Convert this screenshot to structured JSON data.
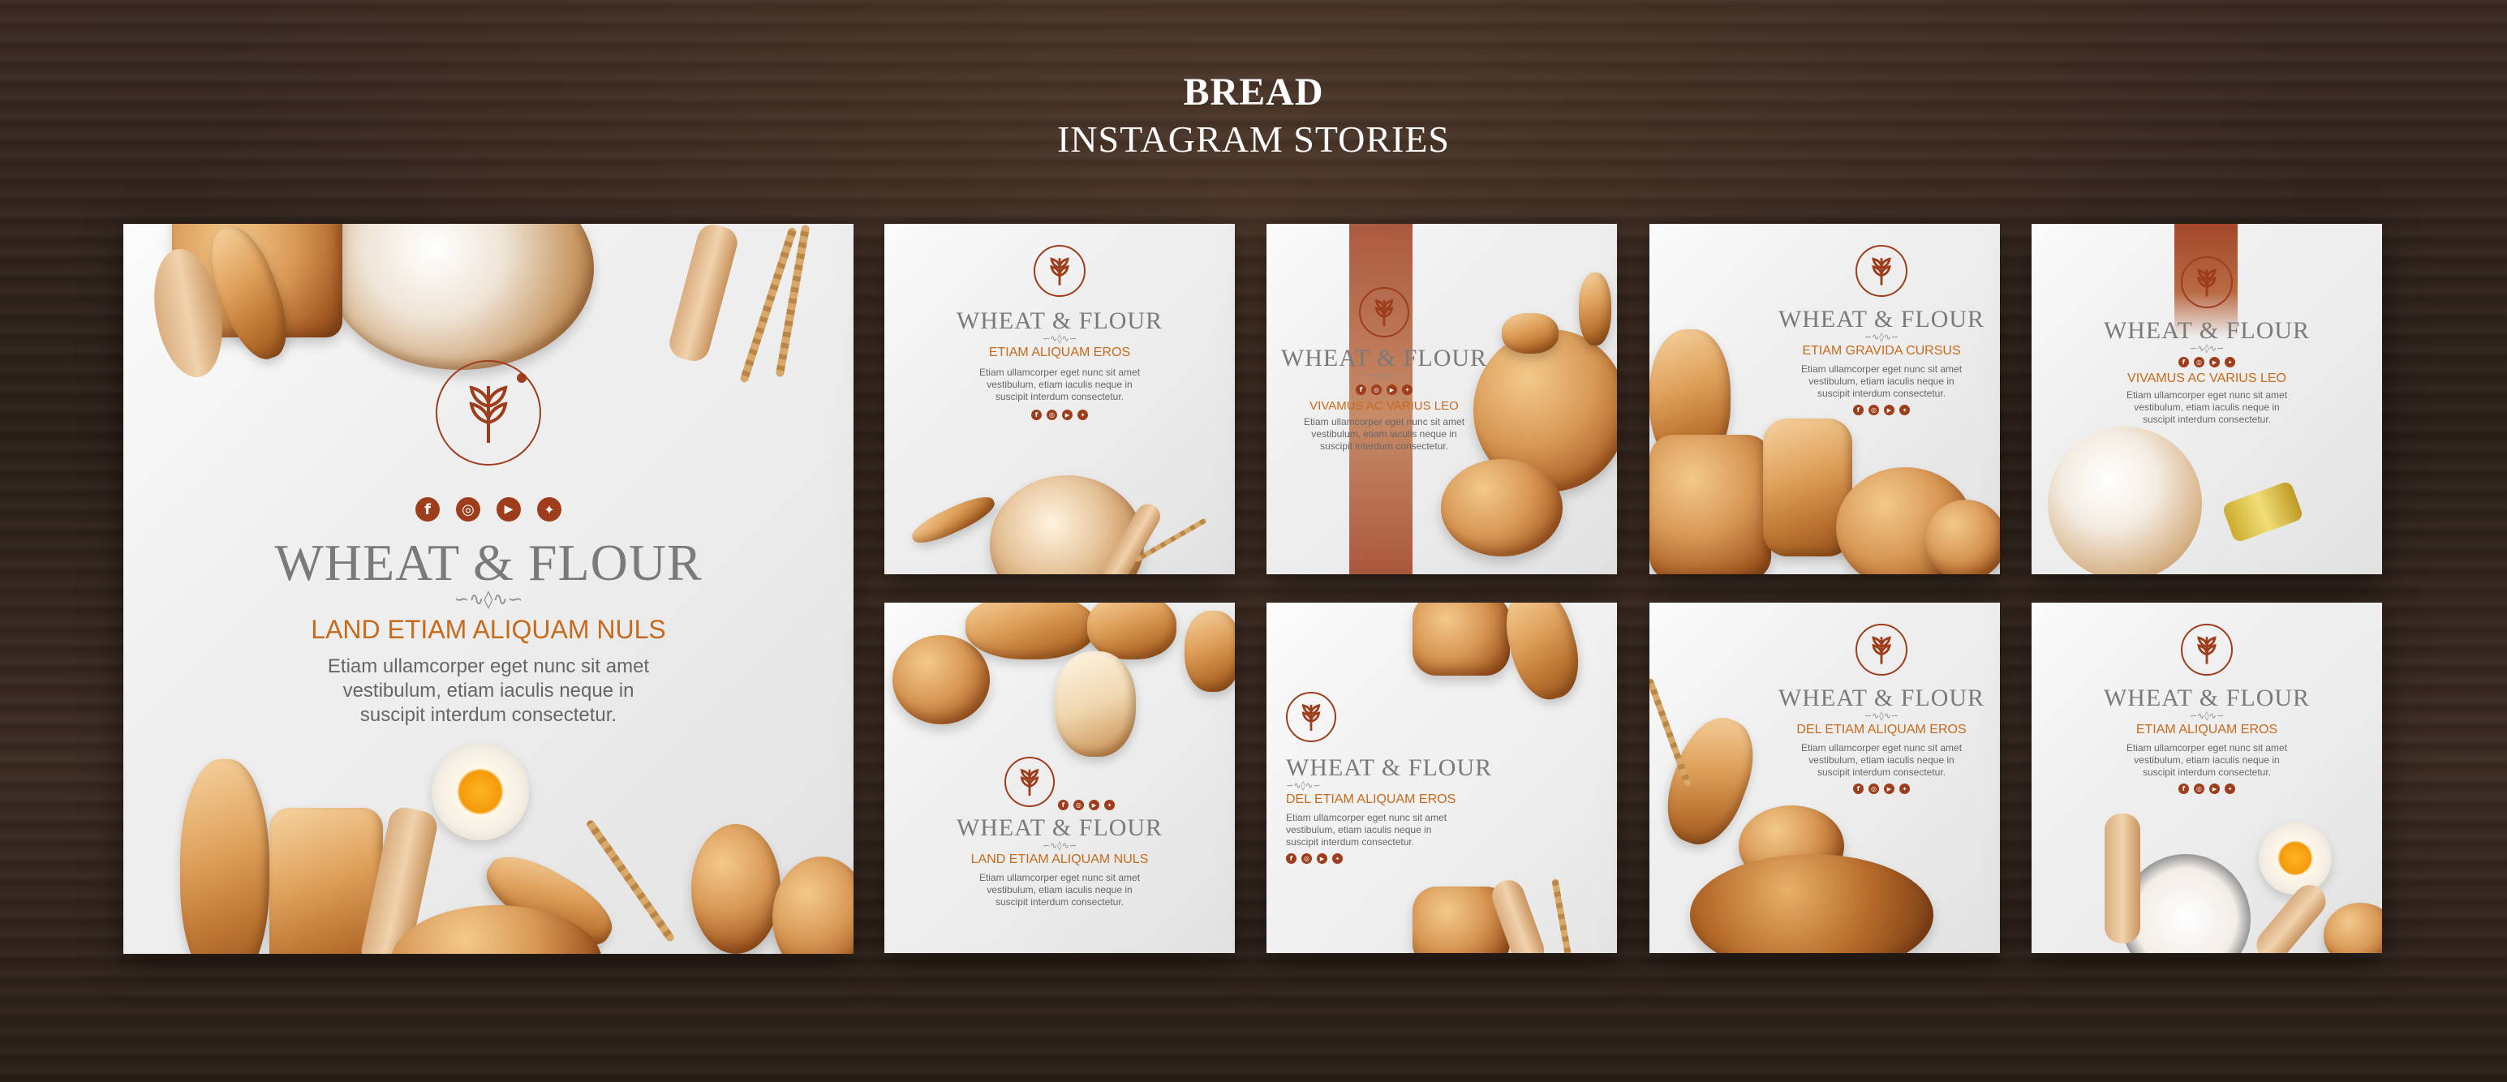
{
  "header": {
    "title": "BREAD",
    "subtitle": "INSTAGRAM STORIES"
  },
  "colors": {
    "brand_brown": "#9e3d1c",
    "accent_orange": "#c66a1d",
    "brand_gray": "#7a7a7a"
  },
  "social_icons": [
    "facebook-icon",
    "instagram-icon",
    "youtube-icon",
    "twitter-icon"
  ],
  "ornament": "∽∿◊∿∽",
  "cards": [
    {
      "brand": "WHEAT & FLOUR",
      "tagline": "LAND ETIAM ALIQUAM NULS",
      "body": "Etiam ullamcorper eget nunc sit amet vestibulum, etiam iaculis neque in suscipit interdum consectetur."
    },
    {
      "brand": "WHEAT & FLOUR",
      "tagline": "ETIAM ALIQUAM EROS",
      "body": "Etiam ullamcorper eget nunc sit amet vestibulum, etiam iaculis neque in suscipit interdum consectetur."
    },
    {
      "brand": "WHEAT & FLOUR",
      "tagline": "VIVAMUS AC VARIUS LEO",
      "body": "Etiam ullamcorper eget nunc sit amet vestibulum, etiam iaculis neque in suscipit interdum consectetur."
    },
    {
      "brand": "WHEAT & FLOUR",
      "tagline": "ETIAM GRAVIDA CURSUS",
      "body": "Etiam ullamcorper eget nunc sit amet vestibulum, etiam iaculis neque in suscipit interdum consectetur."
    },
    {
      "brand": "WHEAT & FLOUR",
      "tagline": "VIVAMUS AC VARIUS LEO",
      "body": "Etiam ullamcorper eget nunc sit amet vestibulum, etiam iaculis neque in suscipit interdum consectetur."
    },
    {
      "brand": "WHEAT & FLOUR",
      "tagline": "LAND ETIAM ALIQUAM NULS",
      "body": "Etiam ullamcorper eget nunc sit amet vestibulum, etiam iaculis neque in suscipit interdum consectetur."
    },
    {
      "brand": "WHEAT & FLOUR",
      "tagline": "DEL ETIAM ALIQUAM EROS",
      "body": "Etiam ullamcorper eget nunc sit amet vestibulum, etiam iaculis neque in suscipit interdum consectetur."
    },
    {
      "brand": "WHEAT & FLOUR",
      "tagline": "DEL ETIAM ALIQUAM EROS",
      "body": "Etiam ullamcorper eget nunc sit amet vestibulum, etiam iaculis neque in suscipit interdum consectetur."
    },
    {
      "brand": "WHEAT & FLOUR",
      "tagline": "ETIAM ALIQUAM EROS",
      "body": "Etiam ullamcorper eget nunc sit amet vestibulum, etiam iaculis neque in suscipit interdum consectetur."
    }
  ]
}
